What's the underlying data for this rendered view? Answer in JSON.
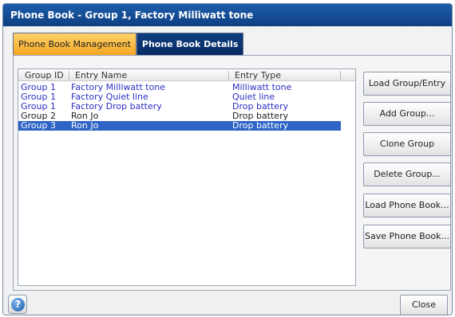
{
  "window": {
    "title": "Phone Book - Group 1, Factory Milliwatt tone"
  },
  "tabs": [
    {
      "label": "Phone Book Management",
      "active": true
    },
    {
      "label": "Phone Book Details",
      "active": false
    }
  ],
  "table": {
    "columns": [
      "Group ID",
      "Entry Name",
      "Entry Type"
    ],
    "rows": [
      {
        "group": "Group 1",
        "name": "Factory Milliwatt tone",
        "type": "Milliwatt tone",
        "style": "blue"
      },
      {
        "group": "Group 1",
        "name": "Factory Quiet line",
        "type": "Quiet line",
        "style": "blue"
      },
      {
        "group": "Group 1",
        "name": "Factory Drop battery",
        "type": "Drop battery",
        "style": "blue"
      },
      {
        "group": "Group 2",
        "name": "Ron Jo",
        "type": "Drop battery",
        "style": "black"
      },
      {
        "group": "Group 3",
        "name": "Ron Jo",
        "type": "Drop battery",
        "style": "selected"
      }
    ]
  },
  "actions": {
    "load_group_entry": "Load Group/Entry",
    "add_group": "Add Group...",
    "clone_group": "Clone Group",
    "delete_group": "Delete Group...",
    "load_phone_book": "Load Phone Book...",
    "save_phone_book": "Save Phone Book..."
  },
  "footer": {
    "help_glyph": "?",
    "close_label": "Close"
  },
  "colors": {
    "title_bar": "#0f3f82",
    "active_tab": "#f3a623",
    "selection": "#2d64c6",
    "factory_entry_text": "#2c2fc4"
  }
}
